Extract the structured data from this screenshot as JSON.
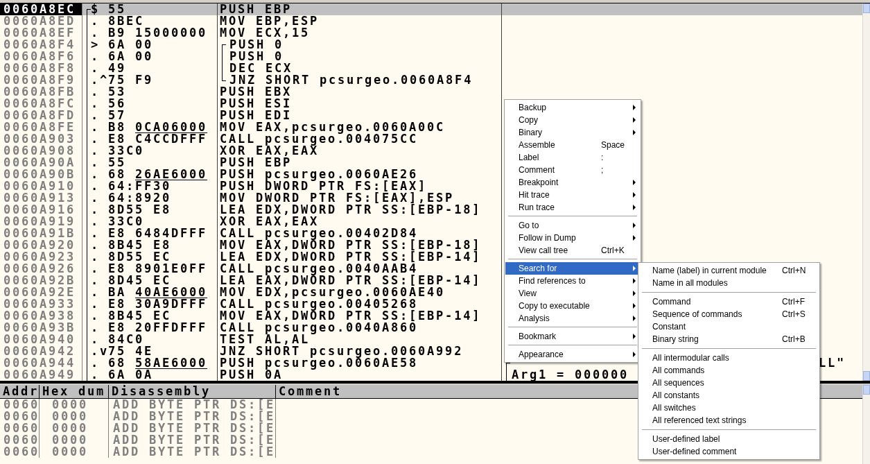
{
  "cpu": {
    "rows": [
      {
        "address": "0060A8EC",
        "marker": "$",
        "opcode": "55",
        "disasm": "PUSH EBP",
        "selected": true,
        "in_function": true,
        "in_loop": false,
        "call_args": false
      },
      {
        "address": "0060A8ED",
        "marker": ".",
        "opcode": "8BEC",
        "disasm": "MOV EBP,ESP",
        "selected": false,
        "in_function": true,
        "in_loop": false,
        "call_args": false
      },
      {
        "address": "0060A8EF",
        "marker": ".",
        "opcode": "B9",
        "operand": "15000000",
        "relocated": false,
        "disasm": "MOV ECX,15",
        "selected": false,
        "in_function": true,
        "in_loop": false,
        "call_args": false
      },
      {
        "address": "0060A8F4",
        "marker": ">",
        "opcode": "6A",
        "operand": "00",
        "relocated": false,
        "disasm": "PUSH 0",
        "selected": false,
        "in_function": true,
        "in_loop": true,
        "call_args": false
      },
      {
        "address": "0060A8F6",
        "marker": ".",
        "opcode": "6A",
        "operand": "00",
        "relocated": false,
        "disasm": "PUSH 0",
        "selected": false,
        "in_function": true,
        "in_loop": true,
        "call_args": false
      },
      {
        "address": "0060A8F8",
        "marker": ".",
        "opcode": "49",
        "disasm": "DEC ECX",
        "selected": false,
        "in_function": true,
        "in_loop": true,
        "call_args": false
      },
      {
        "address": "0060A8F9",
        "marker": ".^",
        "opcode": "75",
        "operand": "F9",
        "relocated": false,
        "disasm": "JNZ SHORT pcsurgeo.0060A8F4",
        "selected": false,
        "in_function": true,
        "in_loop": true,
        "call_args": false
      },
      {
        "address": "0060A8FB",
        "marker": ".",
        "opcode": "53",
        "disasm": "PUSH EBX",
        "selected": false,
        "in_function": true,
        "in_loop": false,
        "call_args": false
      },
      {
        "address": "0060A8FC",
        "marker": ".",
        "opcode": "56",
        "disasm": "PUSH ESI",
        "selected": false,
        "in_function": true,
        "in_loop": false,
        "call_args": false
      },
      {
        "address": "0060A8FD",
        "marker": ".",
        "opcode": "57",
        "disasm": "PUSH EDI",
        "selected": false,
        "in_function": true,
        "in_loop": false,
        "call_args": false
      },
      {
        "address": "0060A8FE",
        "marker": ".",
        "opcode": "B8",
        "operand": "0CA06000",
        "relocated": true,
        "disasm": "MOV EAX,pcsurgeo.0060A00C",
        "selected": false,
        "in_function": true,
        "in_loop": false,
        "call_args": false
      },
      {
        "address": "0060A903",
        "marker": ".",
        "opcode": "E8",
        "operand": "C4CCDFFF",
        "relocated": false,
        "disasm": "CALL pcsurgeo.004075CC",
        "selected": false,
        "in_function": true,
        "in_loop": false,
        "call_args": false
      },
      {
        "address": "0060A908",
        "marker": ".",
        "opcode": "33C0",
        "disasm": "XOR EAX,EAX",
        "selected": false,
        "in_function": true,
        "in_loop": false,
        "call_args": false
      },
      {
        "address": "0060A90A",
        "marker": ".",
        "opcode": "55",
        "disasm": "PUSH EBP",
        "selected": false,
        "in_function": true,
        "in_loop": false,
        "call_args": false
      },
      {
        "address": "0060A90B",
        "marker": ".",
        "opcode": "68",
        "operand": "26AE6000",
        "relocated": true,
        "disasm": "PUSH pcsurgeo.0060AE26",
        "selected": false,
        "in_function": true,
        "in_loop": false,
        "call_args": false
      },
      {
        "address": "0060A910",
        "marker": ".",
        "opcode": "64:FF30",
        "disasm": "PUSH DWORD PTR FS:[EAX]",
        "selected": false,
        "in_function": true,
        "in_loop": false,
        "call_args": false
      },
      {
        "address": "0060A913",
        "marker": ".",
        "opcode": "64:8920",
        "disasm": "MOV DWORD PTR FS:[EAX],ESP",
        "selected": false,
        "in_function": true,
        "in_loop": false,
        "call_args": false
      },
      {
        "address": "0060A916",
        "marker": ".",
        "opcode": "8D55",
        "operand": "E8",
        "relocated": false,
        "disasm": "LEA EDX,DWORD PTR SS:[EBP-18]",
        "selected": false,
        "in_function": true,
        "in_loop": false,
        "call_args": false
      },
      {
        "address": "0060A919",
        "marker": ".",
        "opcode": "33C0",
        "disasm": "XOR EAX,EAX",
        "selected": false,
        "in_function": true,
        "in_loop": false,
        "call_args": false
      },
      {
        "address": "0060A91B",
        "marker": ".",
        "opcode": "E8",
        "operand": "6484DFFF",
        "relocated": false,
        "disasm": "CALL pcsurgeo.00402D84",
        "selected": false,
        "in_function": true,
        "in_loop": false,
        "call_args": false
      },
      {
        "address": "0060A920",
        "marker": ".",
        "opcode": "8B45",
        "operand": "E8",
        "relocated": false,
        "disasm": "MOV EAX,DWORD PTR SS:[EBP-18]",
        "selected": false,
        "in_function": true,
        "in_loop": false,
        "call_args": false
      },
      {
        "address": "0060A923",
        "marker": ".",
        "opcode": "8D55",
        "operand": "EC",
        "relocated": false,
        "disasm": "LEA EDX,DWORD PTR SS:[EBP-14]",
        "selected": false,
        "in_function": true,
        "in_loop": false,
        "call_args": false
      },
      {
        "address": "0060A926",
        "marker": ".",
        "opcode": "E8",
        "operand": "8901E0FF",
        "relocated": false,
        "disasm": "CALL pcsurgeo.0040AAB4",
        "selected": false,
        "in_function": true,
        "in_loop": false,
        "call_args": false
      },
      {
        "address": "0060A92B",
        "marker": ".",
        "opcode": "8D45",
        "operand": "EC",
        "relocated": false,
        "disasm": "LEA EAX,DWORD PTR SS:[EBP-14]",
        "selected": false,
        "in_function": true,
        "in_loop": false,
        "call_args": false
      },
      {
        "address": "0060A92E",
        "marker": ".",
        "opcode": "BA",
        "operand": "40AE6000",
        "relocated": true,
        "disasm": "MOV EDX,pcsurgeo.0060AE40",
        "selected": false,
        "in_function": true,
        "in_loop": false,
        "call_args": false
      },
      {
        "address": "0060A933",
        "marker": ".",
        "opcode": "E8",
        "operand": "30A9DFFF",
        "relocated": false,
        "disasm": "CALL pcsurgeo.00405268",
        "selected": false,
        "in_function": true,
        "in_loop": false,
        "call_args": false
      },
      {
        "address": "0060A938",
        "marker": ".",
        "opcode": "8B45",
        "operand": "EC",
        "relocated": false,
        "disasm": "MOV EAX,DWORD PTR SS:[EBP-14]",
        "selected": false,
        "in_function": true,
        "in_loop": false,
        "call_args": false
      },
      {
        "address": "0060A93B",
        "marker": ".",
        "opcode": "E8",
        "operand": "20FFDFFF",
        "relocated": false,
        "disasm": "CALL pcsurgeo.0040A860",
        "selected": false,
        "in_function": true,
        "in_loop": false,
        "call_args": false
      },
      {
        "address": "0060A940",
        "marker": ".",
        "opcode": "84C0",
        "disasm": "TEST AL,AL",
        "selected": false,
        "in_function": true,
        "in_loop": false,
        "call_args": false
      },
      {
        "address": "0060A942",
        "marker": ".v",
        "opcode": "75",
        "operand": "4E",
        "relocated": false,
        "disasm": "JNZ SHORT pcsurgeo.0060A992",
        "selected": false,
        "in_function": true,
        "in_loop": false,
        "call_args": false
      },
      {
        "address": "0060A944",
        "marker": ".",
        "opcode": "68",
        "operand": "58AE6000",
        "relocated": true,
        "disasm": "PUSH pcsurgeo.0060AE58",
        "selected": false,
        "in_function": true,
        "in_loop": false,
        "call_args": true,
        "comment_tail": "LL\""
      },
      {
        "address": "0060A949",
        "marker": ".",
        "opcode": "6A",
        "operand": "0A",
        "relocated": false,
        "disasm": "PUSH 0A",
        "selected": false,
        "in_function": true,
        "in_loop": false,
        "call_args": true,
        "comment": "Arg1 = 000000"
      }
    ]
  },
  "dump": {
    "columns": [
      "Addr",
      "Hex dum",
      "Disassembly",
      "Comment"
    ],
    "rows": [
      {
        "address": "0060",
        "hex": "0000",
        "disasm": "ADD BYTE PTR DS:[E"
      },
      {
        "address": "0060",
        "hex": "0000",
        "disasm": "ADD BYTE PTR DS:[E"
      },
      {
        "address": "0060",
        "hex": "0000",
        "disasm": "ADD BYTE PTR DS:[E"
      },
      {
        "address": "0060",
        "hex": "0000",
        "disasm": "ADD BYTE PTR DS:[E"
      },
      {
        "address": "0060",
        "hex": "0000",
        "disasm": "ADD BYTE PTR DS:[E"
      }
    ]
  },
  "context_menu": {
    "items": [
      {
        "kind": "item",
        "label": "Backup",
        "submenu": true,
        "selected": false
      },
      {
        "kind": "item",
        "label": "Copy",
        "submenu": true,
        "selected": false
      },
      {
        "kind": "item",
        "label": "Binary",
        "submenu": true,
        "selected": false
      },
      {
        "kind": "item",
        "label": "Assemble",
        "shortcut": "Space",
        "submenu": false,
        "selected": false
      },
      {
        "kind": "item",
        "label": "Label",
        "shortcut": ":",
        "submenu": false,
        "selected": false
      },
      {
        "kind": "item",
        "label": "Comment",
        "shortcut": ";",
        "submenu": false,
        "selected": false
      },
      {
        "kind": "item",
        "label": "Breakpoint",
        "submenu": true,
        "selected": false
      },
      {
        "kind": "item",
        "label": "Hit trace",
        "submenu": true,
        "selected": false
      },
      {
        "kind": "item",
        "label": "Run trace",
        "submenu": true,
        "selected": false
      },
      {
        "kind": "separator"
      },
      {
        "kind": "item",
        "label": "Go to",
        "submenu": true,
        "selected": false
      },
      {
        "kind": "item",
        "label": "Follow in Dump",
        "submenu": true,
        "selected": false
      },
      {
        "kind": "item",
        "label": "View call tree",
        "shortcut": "Ctrl+K",
        "submenu": false,
        "selected": false
      },
      {
        "kind": "separator"
      },
      {
        "kind": "item",
        "label": "Search for",
        "submenu": true,
        "selected": true
      },
      {
        "kind": "item",
        "label": "Find references to",
        "submenu": true,
        "selected": false
      },
      {
        "kind": "item",
        "label": "View",
        "submenu": true,
        "selected": false
      },
      {
        "kind": "item",
        "label": "Copy to executable",
        "submenu": true,
        "selected": false
      },
      {
        "kind": "item",
        "label": "Analysis",
        "submenu": true,
        "selected": false
      },
      {
        "kind": "separator"
      },
      {
        "kind": "item",
        "label": "Bookmark",
        "submenu": true,
        "selected": false
      },
      {
        "kind": "separator"
      },
      {
        "kind": "item",
        "label": "Appearance",
        "submenu": true,
        "selected": false
      }
    ]
  },
  "submenu": {
    "items": [
      {
        "kind": "item",
        "label": "Name (label) in current module",
        "shortcut": "Ctrl+N"
      },
      {
        "kind": "item",
        "label": "Name in all modules"
      },
      {
        "kind": "separator"
      },
      {
        "kind": "item",
        "label": "Command",
        "shortcut": "Ctrl+F"
      },
      {
        "kind": "item",
        "label": "Sequence of commands",
        "shortcut": "Ctrl+S"
      },
      {
        "kind": "item",
        "label": "Constant"
      },
      {
        "kind": "item",
        "label": "Binary string",
        "shortcut": "Ctrl+B"
      },
      {
        "kind": "separator"
      },
      {
        "kind": "item",
        "label": "All intermodular calls"
      },
      {
        "kind": "item",
        "label": "All commands"
      },
      {
        "kind": "item",
        "label": "All sequences"
      },
      {
        "kind": "item",
        "label": "All constants"
      },
      {
        "kind": "item",
        "label": "All switches"
      },
      {
        "kind": "item",
        "label": "All referenced text strings"
      },
      {
        "kind": "separator"
      },
      {
        "kind": "item",
        "label": "User-defined label"
      },
      {
        "kind": "item",
        "label": "User-defined comment"
      }
    ]
  }
}
